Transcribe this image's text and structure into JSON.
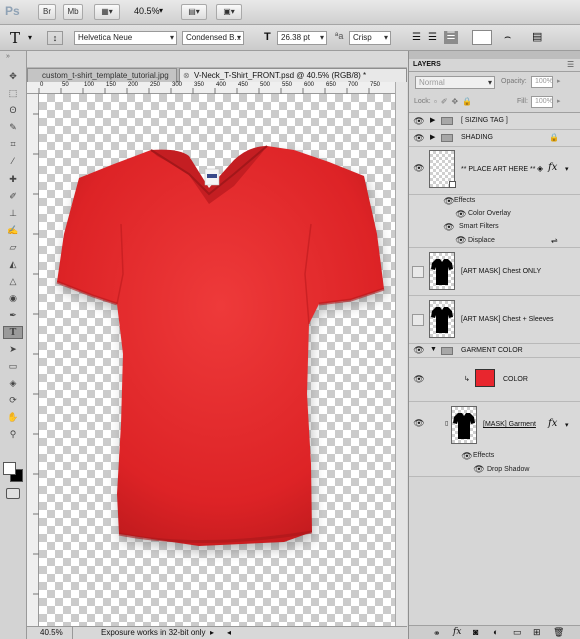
{
  "app": {
    "logo": "Ps",
    "zoom_label": "40.5%"
  },
  "menubar": {
    "bridge_label": "Br",
    "minibridge_label": "Mb",
    "icons": [
      "bridge-icon",
      "mini-bridge-icon",
      "view-extras-icon",
      "arrange-icon",
      "screen-mode-icon"
    ]
  },
  "options": {
    "tool_glyph": "T",
    "font_family": "Helvetica Neue",
    "font_style": "Condensed B...",
    "font_size": "26.38 pt",
    "antialias": "Crisp",
    "icons": [
      "orient-icon",
      "font-size-icon",
      "align-left-icon",
      "align-center-icon",
      "align-right-icon",
      "color-swatch",
      "char-panel-icon"
    ]
  },
  "tabs": [
    {
      "label": "custom_t-shirt_template_tutorial.jpg",
      "active": false
    },
    {
      "label": "V-Neck_T-Shirt_FRONT.psd @ 40.5% (RGB/8) *",
      "active": true
    }
  ],
  "window_title": "V-Neck_T-Shirt_FRONT.psd @ 40.5% (RGB/8) *",
  "ruler_ticks": [
    "0",
    "50",
    "100",
    "150",
    "200",
    "250",
    "300",
    "350",
    "400",
    "450",
    "500",
    "550",
    "600",
    "650",
    "700",
    "750"
  ],
  "status": {
    "zoom": "40.5%",
    "message": "Exposure works in 32-bit only"
  },
  "garment": {
    "color": "#e0292b",
    "neck": "V-neck",
    "has_tag": true
  },
  "layers_panel": {
    "title": "LAYERS",
    "blend_mode": "Normal",
    "opacity_label": "Opacity:",
    "opacity_value": "100%",
    "lock_label": "Lock:",
    "fill_label": "Fill:",
    "fill_value": "100%",
    "rows": [
      {
        "name": "[ SIZING TAG ]",
        "kind": "group"
      },
      {
        "name": "SHADING",
        "kind": "group"
      },
      {
        "name": "** PLACE ART HERE **",
        "kind": "smart"
      },
      {
        "name": "Effects",
        "kind": "sub"
      },
      {
        "name": "Color Overlay",
        "kind": "sub"
      },
      {
        "name": "Smart Filters",
        "kind": "sub"
      },
      {
        "name": "Displace",
        "kind": "sub"
      },
      {
        "name": "[ART MASK] Chest ONLY",
        "kind": "layer"
      },
      {
        "name": "[ART MASK] Chest + Sleeves",
        "kind": "layer"
      },
      {
        "name": "GARMENT COLOR",
        "kind": "group"
      },
      {
        "name": "COLOR",
        "kind": "fill"
      },
      {
        "name": "[MASK] Garment",
        "kind": "layer"
      },
      {
        "name": "Effects",
        "kind": "sub"
      },
      {
        "name": "Drop Shadow",
        "kind": "sub"
      }
    ],
    "fx_label": "fx",
    "color_fill": "#e8262e"
  }
}
